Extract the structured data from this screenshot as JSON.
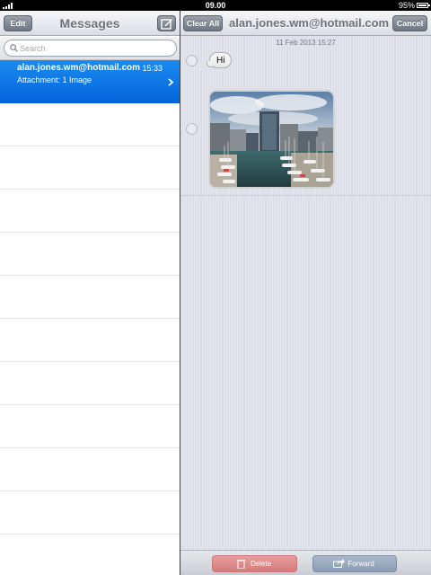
{
  "status_bar": {
    "time": "09.00",
    "battery": "95%",
    "battery_level": 0.95,
    "signal_icon": "signal-bars-icon"
  },
  "left_pane": {
    "edit_label": "Edit",
    "title": "Messages",
    "compose_icon": "compose-icon",
    "search": {
      "placeholder": "Search",
      "value": ""
    },
    "conversations": [
      {
        "sender": "alan.jones.wm@hotmail.com",
        "time": "15:33",
        "preview": "Attachment: 1 Image",
        "selected": true
      }
    ]
  },
  "right_pane": {
    "clear_all_label": "Clear All",
    "title": "alan.jones.wm@hotmail.com",
    "cancel_label": "Cancel",
    "thread": {
      "date": "11 Feb 2013 15:27",
      "messages": [
        {
          "type": "text",
          "text": "Hi"
        },
        {
          "type": "image",
          "description_icon": "harbor-photo"
        }
      ]
    },
    "toolbar": {
      "delete_label": "Delete",
      "forward_label": "Forward"
    }
  },
  "colors": {
    "selection_blue": "#0a72e6",
    "delete_red": "#d17c7c",
    "forward_blue": "#8d9db3"
  }
}
